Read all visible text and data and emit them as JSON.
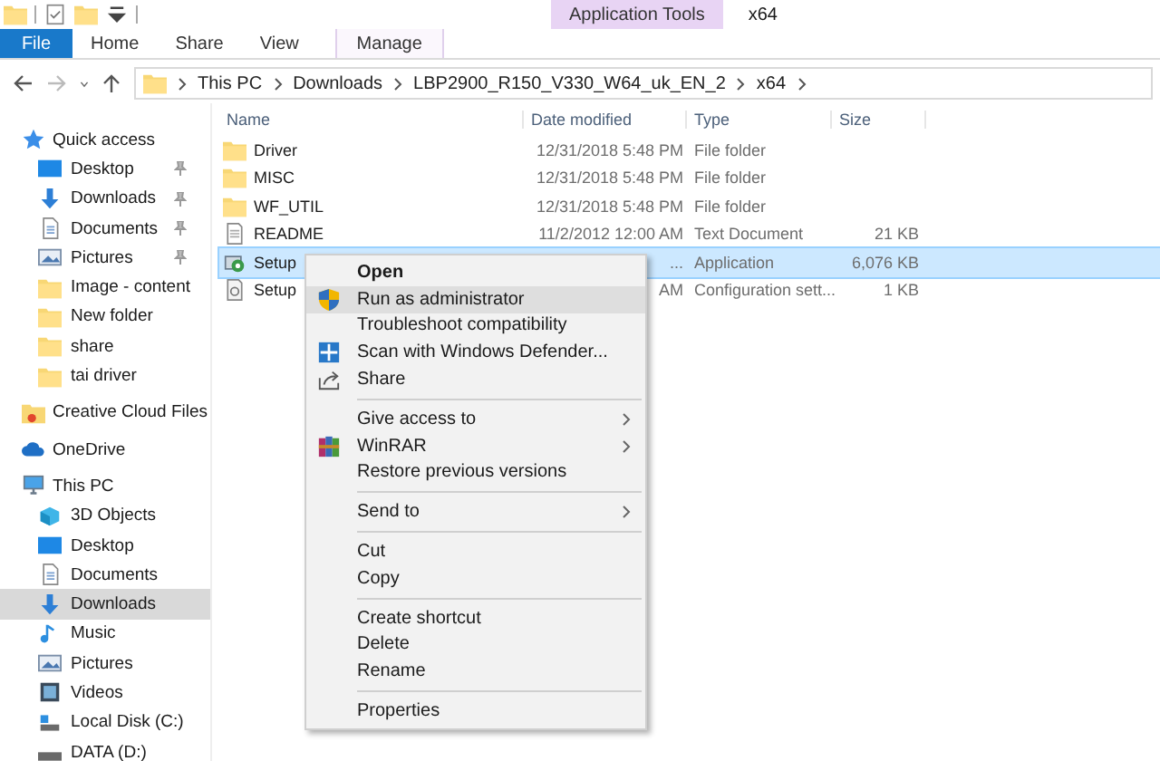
{
  "window": {
    "title": "x64"
  },
  "ribbon": {
    "context_group": "Application Tools",
    "tabs": [
      {
        "label": "File",
        "selected": false,
        "kind": "file"
      },
      {
        "label": "Home",
        "selected": false,
        "kind": "tab"
      },
      {
        "label": "Share",
        "selected": false,
        "kind": "tab"
      },
      {
        "label": "View",
        "selected": false,
        "kind": "tab"
      },
      {
        "label": "Manage",
        "selected": false,
        "kind": "context"
      }
    ]
  },
  "address": {
    "path": [
      "This PC",
      "Downloads",
      "LBP2900_R150_V330_W64_uk_EN_2",
      "x64"
    ]
  },
  "sidebar": {
    "items": [
      {
        "label": "Quick access",
        "selected": false,
        "children": [
          {
            "label": "Desktop",
            "selected": false,
            "pinned": true
          },
          {
            "label": "Downloads",
            "selected": false,
            "pinned": true
          },
          {
            "label": "Documents",
            "selected": false,
            "pinned": true
          },
          {
            "label": "Pictures",
            "selected": false,
            "pinned": true
          },
          {
            "label": "Image - content",
            "selected": false,
            "pinned": false
          },
          {
            "label": "New folder",
            "selected": false,
            "pinned": false
          },
          {
            "label": "share",
            "selected": false,
            "pinned": false
          },
          {
            "label": "tai driver",
            "selected": false,
            "pinned": false
          }
        ]
      },
      {
        "label": "Creative Cloud Files",
        "selected": false
      },
      {
        "label": "OneDrive",
        "selected": false
      },
      {
        "label": "This PC",
        "selected": false,
        "children": [
          {
            "label": "3D Objects",
            "selected": false
          },
          {
            "label": "Desktop",
            "selected": false
          },
          {
            "label": "Documents",
            "selected": false
          },
          {
            "label": "Downloads",
            "selected": true
          },
          {
            "label": "Music",
            "selected": false
          },
          {
            "label": "Pictures",
            "selected": false
          },
          {
            "label": "Videos",
            "selected": false
          },
          {
            "label": "Local Disk (C:)",
            "selected": false
          },
          {
            "label": "DATA (D:)",
            "selected": false
          }
        ]
      }
    ]
  },
  "table": {
    "columns": [
      "Name",
      "Date modified",
      "Type",
      "Size"
    ],
    "rows": [
      {
        "kind": "folder",
        "name": "Driver",
        "date": "12/31/2018 5:48 PM",
        "type": "File folder",
        "size": "",
        "selected": false
      },
      {
        "kind": "folder",
        "name": "MISC",
        "date": "12/31/2018 5:48 PM",
        "type": "File folder",
        "size": "",
        "selected": false
      },
      {
        "kind": "folder",
        "name": "WF_UTIL",
        "date": "12/31/2018 5:48 PM",
        "type": "File folder",
        "size": "",
        "selected": false
      },
      {
        "kind": "text",
        "name": "README",
        "date": "11/2/2012 12:00 AM",
        "type": "Text Document",
        "size": "21 KB",
        "selected": false
      },
      {
        "kind": "app",
        "name": "Setup",
        "date": "...",
        "type": "Application",
        "size": "6,076 KB",
        "selected": true
      },
      {
        "kind": "config",
        "name": "Setup",
        "date": "AM",
        "type": "Configuration sett...",
        "size": "1 KB",
        "selected": false
      }
    ]
  },
  "context_menu": {
    "items": [
      {
        "kind": "item",
        "label": "Open",
        "bold": true,
        "selected": false,
        "submenu": false
      },
      {
        "kind": "item",
        "label": "Run as administrator",
        "bold": false,
        "selected": true,
        "submenu": false
      },
      {
        "kind": "item",
        "label": "Troubleshoot compatibility",
        "bold": false,
        "selected": false,
        "submenu": false
      },
      {
        "kind": "item",
        "label": "Scan with Windows Defender...",
        "bold": false,
        "selected": false,
        "submenu": false
      },
      {
        "kind": "item",
        "label": "Share",
        "bold": false,
        "selected": false,
        "submenu": false
      },
      {
        "kind": "separator"
      },
      {
        "kind": "item",
        "label": "Give access to",
        "bold": false,
        "selected": false,
        "submenu": true
      },
      {
        "kind": "item",
        "label": "WinRAR",
        "bold": false,
        "selected": false,
        "submenu": true
      },
      {
        "kind": "item",
        "label": "Restore previous versions",
        "bold": false,
        "selected": false,
        "submenu": false
      },
      {
        "kind": "separator"
      },
      {
        "kind": "item",
        "label": "Send to",
        "bold": false,
        "selected": false,
        "submenu": true
      },
      {
        "kind": "separator"
      },
      {
        "kind": "item",
        "label": "Cut",
        "bold": false,
        "selected": false,
        "submenu": false
      },
      {
        "kind": "item",
        "label": "Copy",
        "bold": false,
        "selected": false,
        "submenu": false
      },
      {
        "kind": "separator"
      },
      {
        "kind": "item",
        "label": "Create shortcut",
        "bold": false,
        "selected": false,
        "submenu": false
      },
      {
        "kind": "item",
        "label": "Delete",
        "bold": false,
        "selected": false,
        "submenu": false
      },
      {
        "kind": "item",
        "label": "Rename",
        "bold": false,
        "selected": false,
        "submenu": false
      },
      {
        "kind": "separator"
      },
      {
        "kind": "item",
        "label": "Properties",
        "bold": false,
        "selected": false,
        "submenu": false
      }
    ]
  }
}
